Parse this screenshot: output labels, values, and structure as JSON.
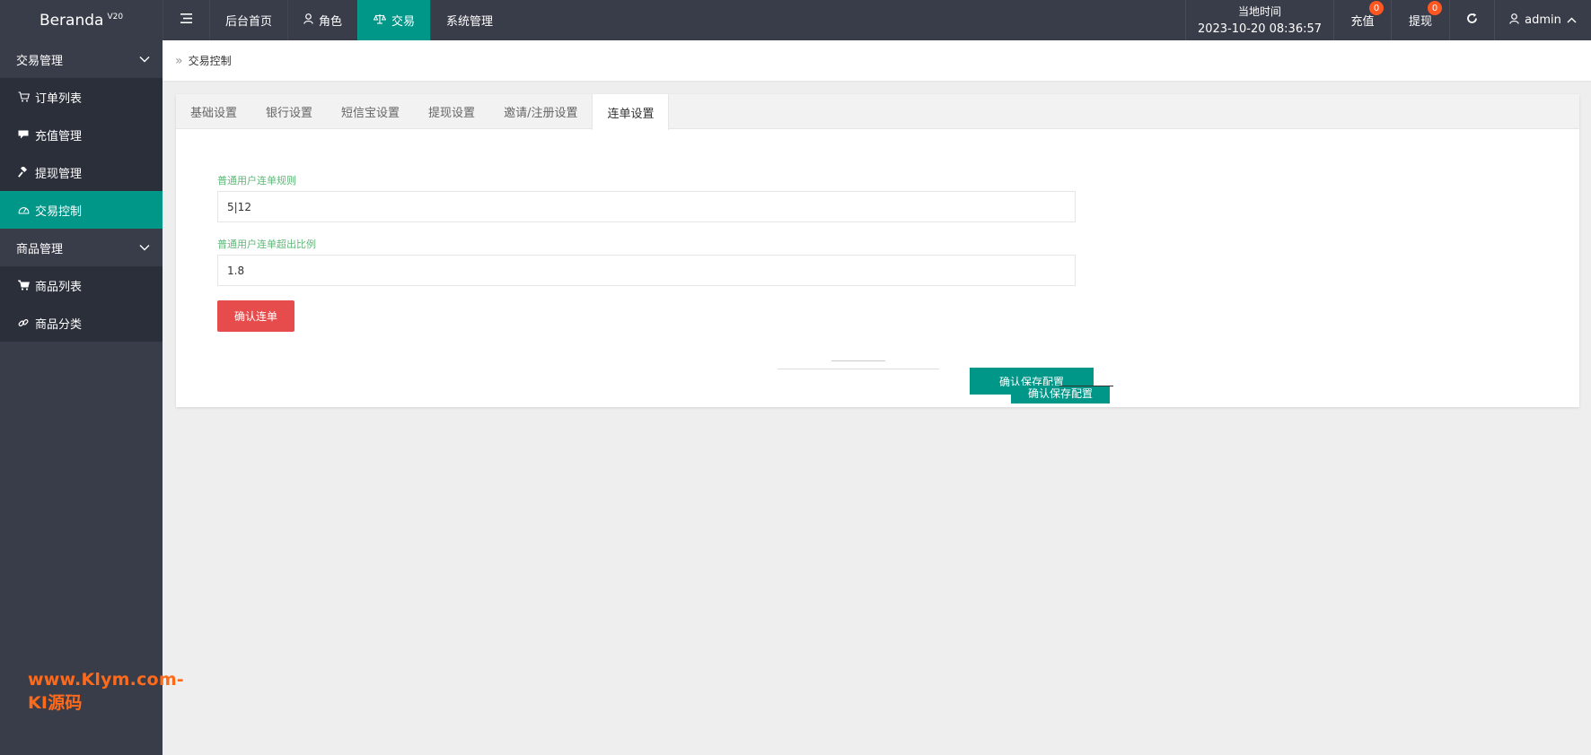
{
  "app": {
    "name": "Beranda",
    "version": "V20"
  },
  "topnav": [
    {
      "label": "后台首页",
      "icon": ""
    },
    {
      "label": "角色",
      "icon": "user-icon"
    },
    {
      "label": "交易",
      "icon": "scale-icon",
      "active": true
    },
    {
      "label": "系统管理",
      "icon": ""
    }
  ],
  "header": {
    "time_label": "当地时间",
    "time_value": "2023-10-20 08:36:57",
    "recharge_label": "充值",
    "recharge_count": "0",
    "withdraw_label": "提现",
    "withdraw_count": "0",
    "user_label": "admin"
  },
  "sidebar": {
    "groups": [
      {
        "label": "交易管理",
        "items": [
          {
            "label": "订单列表",
            "icon": "cart-icon"
          },
          {
            "label": "充值管理",
            "icon": "card-icon"
          },
          {
            "label": "提现管理",
            "icon": "gavel-icon"
          },
          {
            "label": "交易控制",
            "icon": "dashboard-icon",
            "active": true
          }
        ]
      },
      {
        "label": "商品管理",
        "items": [
          {
            "label": "商品列表",
            "icon": "shopping-cart-icon"
          },
          {
            "label": "商品分类",
            "icon": "link-icon"
          }
        ]
      }
    ]
  },
  "watermark": "www.Klym.com-KI源码",
  "breadcrumb": {
    "current": "交易控制"
  },
  "tabs": [
    {
      "label": "基础设置"
    },
    {
      "label": "银行设置"
    },
    {
      "label": "短信宝设置"
    },
    {
      "label": "提现设置"
    },
    {
      "label": "邀请/注册设置"
    },
    {
      "label": "连单设置",
      "active": true
    }
  ],
  "form": {
    "rule_label": "普通用户连单规则",
    "rule_value": "5|12",
    "ratio_label": "普通用户连单超出比例",
    "ratio_value": "1.8",
    "confirm_label": "确认连单",
    "save_label_1": "确认保存配置",
    "save_label_2": "确认保存配置"
  },
  "colors": {
    "accent": "#009688",
    "danger": "#e64c4c",
    "dark": "#393d49",
    "badge": "#ff5722",
    "label_green": "#5fb878"
  }
}
